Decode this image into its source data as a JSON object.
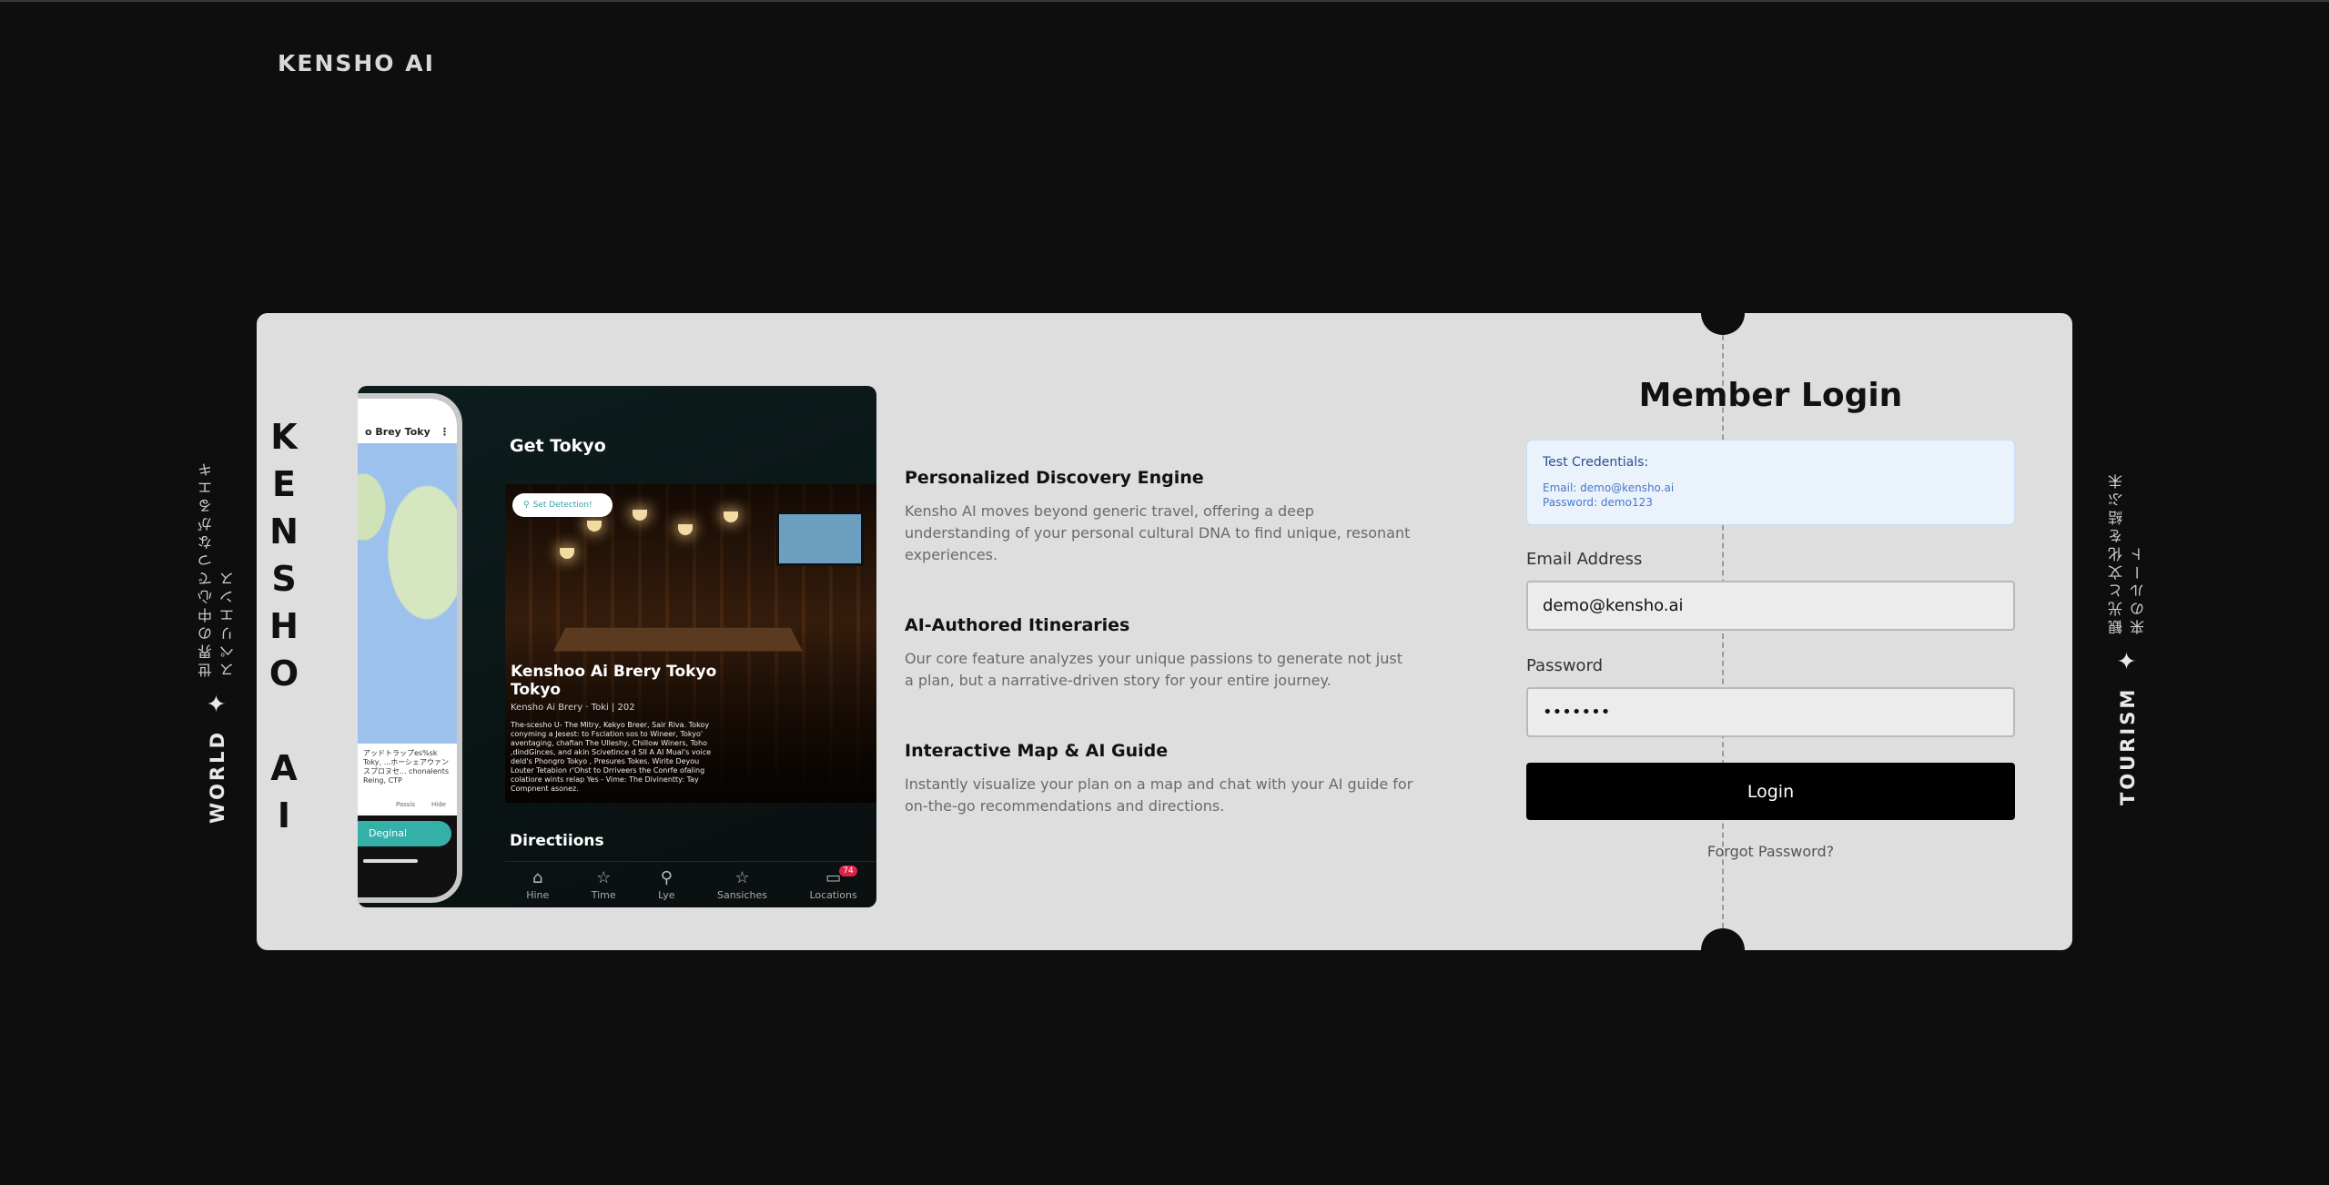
{
  "brand": "KENSHO AI",
  "side_left": {
    "en": "WORLD",
    "star": "✦",
    "jp": "世界の中心でつながるエキスペリエンス"
  },
  "side_right": {
    "en": "TOURISM",
    "star": "✦",
    "jp": "観光と文化を結ぶ未来のルート"
  },
  "vertical_brand": [
    "K",
    "E",
    "N",
    "S",
    "H",
    "O",
    "A",
    "I"
  ],
  "showcase": {
    "phone_map_header": "o Brey Toky",
    "phone_map_text": "アッドトラップes%sk Toky, ...ホーシェアウァンスプロヌセ... chonalents Reing, CTP",
    "phone_tabs": [
      "Passis",
      "Hide"
    ],
    "phone_cta": "Deginal",
    "screen_title": "Get Tokyo",
    "search_pill": "Set Detection!",
    "place_title": "Kenshoo Ai Brery  Tokyo Tokyo",
    "place_sub": "Kensho Ai Brery · Toki  |  202",
    "place_desc": "The-scesho U- The Mitry, Kekyo Breer, Sair Rlva. Tokoy conyming a Jesest: to Fsclation sos to Wineer, Tokyo' aventaging, chafian The Ulleshy, Chillow Winers, Toho ,dindGinces, and akin Scivetince d SlI A AI Mual's voice deld's Phongro Tokyo , Presures Tokes. Wirite Deyou Louter Tetabion r'Ohst to Drriveers the Conrfe ofaling colatiore wints relap Yes - Vime: The Divinentty: Tay Compnent asonez.",
    "directions": "Directiions",
    "tabs": [
      {
        "icon": "⌂",
        "label": "Hine"
      },
      {
        "icon": "☆",
        "label": "Time"
      },
      {
        "icon": "⚲",
        "label": "Lye"
      },
      {
        "icon": "☆",
        "label": "Sansiches"
      },
      {
        "icon": "▭",
        "label": "Locations",
        "badge": "74"
      }
    ]
  },
  "features": [
    {
      "title": "Personalized Discovery Engine",
      "text": "Kensho AI moves beyond generic travel, offering a deep understanding of your personal cultural DNA to find unique, resonant experiences."
    },
    {
      "title": "AI-Authored Itineraries",
      "text": "Our core feature analyzes your unique passions to generate not just a plan, but a narrative-driven story for your entire journey."
    },
    {
      "title": "Interactive Map & AI Guide",
      "text": "Instantly visualize your plan on a map and chat with your AI guide for on-the-go recommendations and directions."
    }
  ],
  "login": {
    "title": "Member Login",
    "creds_title": "Test Credentials:",
    "creds_email": "Email: demo@kensho.ai",
    "creds_password": "Password: demo123",
    "email_label": "Email Address",
    "email_value": "demo@kensho.ai",
    "password_label": "Password",
    "password_value": "•••••••",
    "button": "Login",
    "forgot": "Forgot Password?"
  }
}
